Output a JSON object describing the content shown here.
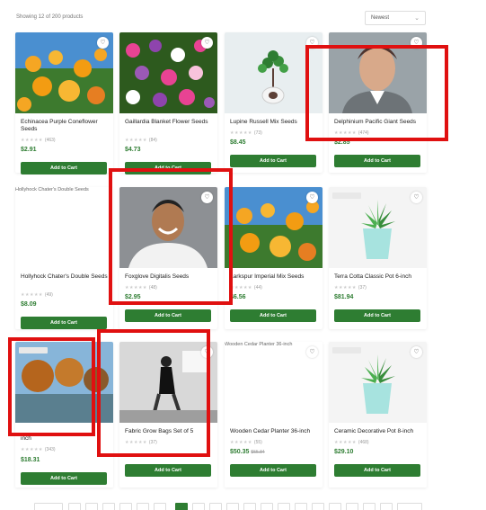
{
  "toolbar": {
    "showing": "Showing 12 of 200 products",
    "sort_value": "Newest"
  },
  "products": [
    {
      "name": "Echinacea Purple Coneflower Seeds",
      "reviews": "(463)",
      "price": "$2.91",
      "old_price": "",
      "button": "Add to Cart",
      "alt": ""
    },
    {
      "name": "Gaillardia Blanket Flower Seeds",
      "reviews": "(84)",
      "price": "$4.73",
      "old_price": "",
      "button": "Add to Cart",
      "alt": ""
    },
    {
      "name": "Lupine Russell Mix Seeds",
      "reviews": "(73)",
      "price": "$8.45",
      "old_price": "",
      "button": "Add to Cart",
      "alt": ""
    },
    {
      "name": "Delphinium Pacific Giant Seeds",
      "reviews": "(474)",
      "price": "$2.85",
      "old_price": "",
      "button": "Add to Cart",
      "alt": ""
    },
    {
      "name": "Hollyhock Chater's Double Seeds",
      "reviews": "(49)",
      "price": "$8.09",
      "old_price": "",
      "button": "Add to Cart",
      "alt": "Hollyhock Chater's Double Seeds"
    },
    {
      "name": "Foxglove Digitalis Seeds",
      "reviews": "(48)",
      "price": "$2.95",
      "old_price": "",
      "button": "Add to Cart",
      "alt": ""
    },
    {
      "name": "Larkspur Imperial Mix Seeds",
      "reviews": "(44)",
      "price": "$6.56",
      "old_price": "",
      "button": "Add to Cart",
      "alt": ""
    },
    {
      "name": "Terra Cotta Classic Pot 6-inch",
      "reviews": "(37)",
      "price": "$81.94",
      "old_price": "",
      "button": "Add to Cart",
      "alt": ""
    },
    {
      "name": "inch",
      "reviews": "(343)",
      "price": "$18.31",
      "old_price": "",
      "button": "Add to Cart",
      "alt": ""
    },
    {
      "name": "Fabric Grow Bags Set of 5",
      "reviews": "(37)",
      "price": "",
      "old_price": "",
      "button": "Add to Cart",
      "alt": ""
    },
    {
      "name": "Wooden Cedar Planter 36-inch",
      "reviews": "(55)",
      "price": "$50.35",
      "old_price": "$55.84",
      "button": "Add to Cart",
      "alt": "Wooden Cedar Planter 36-inch"
    },
    {
      "name": "Ceramic Decorative Pot 8-inch",
      "reviews": "(468)",
      "price": "$29.10",
      "old_price": "",
      "button": "Add to Cart",
      "alt": ""
    }
  ],
  "icons": {
    "heart": "heart-icon",
    "chevron": "chevron-down-icon"
  },
  "colors": {
    "accent": "#2e7d32",
    "highlight": "#e01010"
  }
}
